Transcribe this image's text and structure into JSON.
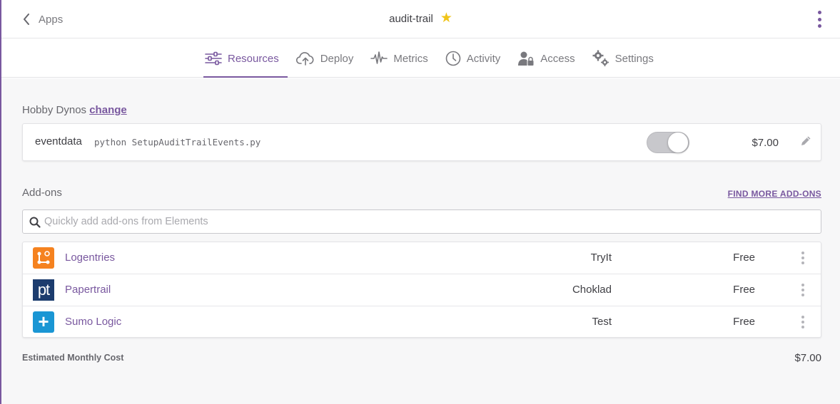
{
  "header": {
    "back_label": "Apps",
    "app_name": "audit-trail",
    "favorite_star": "★"
  },
  "tabs": [
    {
      "label": "Resources",
      "icon": "sliders-icon",
      "active": true
    },
    {
      "label": "Deploy",
      "icon": "cloud-upload-icon",
      "active": false
    },
    {
      "label": "Metrics",
      "icon": "pulse-icon",
      "active": false
    },
    {
      "label": "Activity",
      "icon": "clock-icon",
      "active": false
    },
    {
      "label": "Access",
      "icon": "user-lock-icon",
      "active": false
    },
    {
      "label": "Settings",
      "icon": "gears-icon",
      "active": false
    }
  ],
  "dynos": {
    "section_label": "Hobby Dynos",
    "change_label": "change",
    "items": [
      {
        "name": "eventdata",
        "command": "python SetupAuditTrailEvents.py",
        "enabled": true,
        "price": "$7.00"
      }
    ]
  },
  "addons": {
    "section_label": "Add-ons",
    "find_more_label": "FIND MORE ADD-ONS",
    "search_placeholder": "Quickly add add-ons from Elements",
    "items": [
      {
        "name": "Logentries",
        "attachment": "TryIt",
        "plan": "Free",
        "logo_text": "",
        "logo_color": "#f5821f"
      },
      {
        "name": "Papertrail",
        "attachment": "Choklad",
        "plan": "Free",
        "logo_text": "pt",
        "logo_color": "#1c3c6e"
      },
      {
        "name": "Sumo Logic",
        "attachment": "Test",
        "plan": "Free",
        "logo_text": "+",
        "logo_color": "#1a96d4"
      }
    ]
  },
  "summary": {
    "label": "Estimated Monthly Cost",
    "value": "$7.00"
  },
  "colors": {
    "accent": "#79589f",
    "star": "#f0c419",
    "background": "#f7f7f8"
  }
}
